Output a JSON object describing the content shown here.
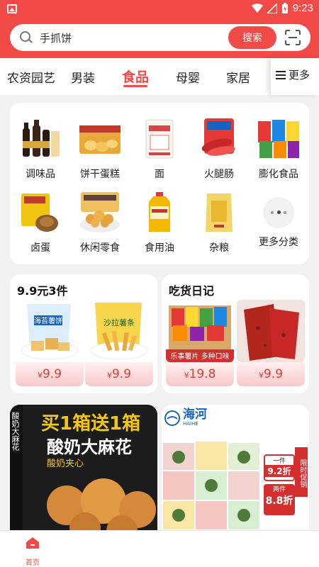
{
  "status_bar": {
    "time": "9:23"
  },
  "search": {
    "query": "手抓饼",
    "button_label": "搜索"
  },
  "tabs": [
    {
      "label": "农资园艺",
      "active": false
    },
    {
      "label": "男装",
      "active": false
    },
    {
      "label": "食品",
      "active": true
    },
    {
      "label": "母婴",
      "active": false
    },
    {
      "label": "家居",
      "active": false
    }
  ],
  "more_tab_label": "更多",
  "categories": [
    {
      "label": "调味品",
      "icon": "soy-sauce-bottles"
    },
    {
      "label": "饼干蛋糕",
      "icon": "cake-box"
    },
    {
      "label": "面",
      "icon": "flour-bag"
    },
    {
      "label": "火腿肠",
      "icon": "sausage-pack"
    },
    {
      "label": "膨化食品",
      "icon": "snack-bags"
    },
    {
      "label": "卤蛋",
      "icon": "braised-egg"
    },
    {
      "label": "休闲零食",
      "icon": "popcorn"
    },
    {
      "label": "食用油",
      "icon": "oil-bottle"
    },
    {
      "label": "杂粮",
      "icon": "grain-bag"
    },
    {
      "label": "更多分类",
      "icon": "more-dots"
    }
  ],
  "promos": [
    {
      "title": "9.9元3件",
      "products": [
        {
          "currency": "¥",
          "price": "9.9",
          "pic_label": "海苔薯饼"
        },
        {
          "currency": "¥",
          "price": "9.9",
          "pic_label": "沙拉薯条"
        }
      ]
    },
    {
      "title": "吃货日记",
      "products": [
        {
          "currency": "¥",
          "price": "19.8",
          "pic_label": "乐事薯片 多种口味"
        },
        {
          "currency": "¥",
          "price": "9.9",
          "pic_label": ""
        }
      ]
    }
  ],
  "banners": {
    "left": {
      "line1": "买1箱送1箱",
      "line2": "酸奶大麻花",
      "line3": "酸奶夹心",
      "side_text": "酸奶大麻花"
    },
    "right": {
      "brand": "海河",
      "brand_sub": "HAIHE",
      "tag1_top": "一件",
      "tag1_value": "9.2折",
      "tag2_top": "两件",
      "tag2_value": "8.8折",
      "side": "限时促销"
    }
  },
  "bottom_nav": {
    "home_label": "首页"
  },
  "colors": {
    "brand_red": "#f24a46",
    "price_red": "#e53935"
  }
}
